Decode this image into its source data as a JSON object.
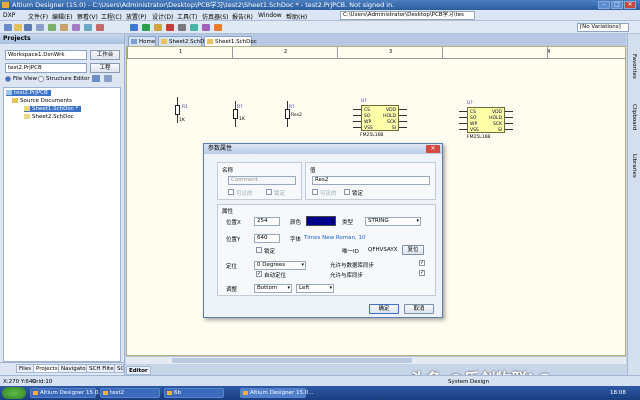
{
  "window": {
    "title": "Altium Designer (15.0) - C:\\Users\\Administrator\\Desktop\\PCB学习\\test2\\Sheet1.SchDoc * - test2.PrjPCB. Not signed in.",
    "min": "–",
    "max": "□",
    "close": "✕"
  },
  "menu": {
    "items": [
      "DXP",
      "文件(F)",
      "编辑(E)",
      "察看(V)",
      "工程(C)",
      "放置(P)",
      "设计(D)",
      "工具(T)",
      "仿真器(S)",
      "报告(R)",
      "Window",
      "帮助(H)"
    ],
    "path_field": "C:\\Users\\Administrator\\Desktop\\PCB学习\\tes"
  },
  "toolbar": {
    "variations": "[No Variations]"
  },
  "projects_panel": {
    "header": "Projects",
    "workspace_value": "Workspace1.DsnWrk",
    "workspace_button": "工作台",
    "project_value": "test2.PrjPCB",
    "project_button": "工程",
    "view_file": "File View",
    "view_structure": "Structure Editor",
    "tree": {
      "project": "test2.PrjPCB",
      "folder": "Source Documents",
      "docs": [
        "Sheet1.SchDoc *",
        "Sheet2.SchDoc"
      ]
    },
    "tabs": [
      "Files",
      "Projects",
      "Navigator",
      "SCH Filter",
      "SCH",
      "Editor"
    ]
  },
  "doc_tabs": [
    "Home",
    "Sheet2.SchDoc",
    "Sheet1.SchDoc *"
  ],
  "ruler": [
    "1",
    "2",
    "3",
    "4"
  ],
  "schematic": {
    "resistors": [
      {
        "designator": "R1",
        "value": "1K"
      },
      {
        "designator": "R?",
        "value": "1K"
      },
      {
        "designator": "R?",
        "value": "Res2"
      }
    ],
    "chips": [
      {
        "designator": "U?",
        "part": "FM25L16B",
        "pins_left": [
          "CS",
          "SO",
          "WP",
          "VSS"
        ],
        "pins_right": [
          "VDD",
          "HOLD",
          "SCK",
          "SI"
        ]
      },
      {
        "designator": "U?",
        "part": "FM25L16B",
        "pins_left": [
          "CS",
          "SO",
          "WP",
          "VSS"
        ],
        "pins_right": [
          "VDD",
          "HOLD",
          "SCK",
          "SI"
        ]
      }
    ]
  },
  "dialog": {
    "title": "参数属性",
    "close": "✕",
    "name_group": "名称",
    "name_value": "Comment",
    "name_visible": "可见的",
    "name_lock": "锁定",
    "value_group": "值",
    "value_value": "Res2",
    "value_visible": "可见的",
    "value_lock": "锁定",
    "props_group": "属性",
    "pos_x_label": "位置X",
    "pos_x": "254",
    "color_label": "颜色",
    "type_label": "类型",
    "type_value": "STRING",
    "pos_y_label": "位置Y",
    "pos_y": "640",
    "font_label": "字体",
    "font_value": "Times New Roman, 10",
    "lock_label": "锁定",
    "uid_label": "唯一ID",
    "uid_value": "QFHVSAYX",
    "reset_button": "复位",
    "locate_label": "定位",
    "rotation_value": "0 Degrees",
    "auto_pos_label": "自动定位",
    "allow_db_sync": "允许与数据库同步",
    "allow_lib_sync": "允许与库同步",
    "justify_label": "调整",
    "justify_v": "Bottom",
    "justify_h": "Left",
    "ok_button": "确定",
    "cancel_button": "取消",
    "accent_color": "#00008b"
  },
  "right_panels": [
    "Favorites",
    "Clipboard",
    "Libraries"
  ],
  "status": {
    "coords": "X:270 Y:640",
    "grid": "Grid:10",
    "system": "System",
    "design": "Design"
  },
  "taskbar": {
    "items": [
      "Altium Designer 15.0...",
      "test2",
      "6b",
      "Altium Designer 15.0..."
    ],
    "time": "18:08"
  },
  "watermark": "头条 @乐创物联LC"
}
